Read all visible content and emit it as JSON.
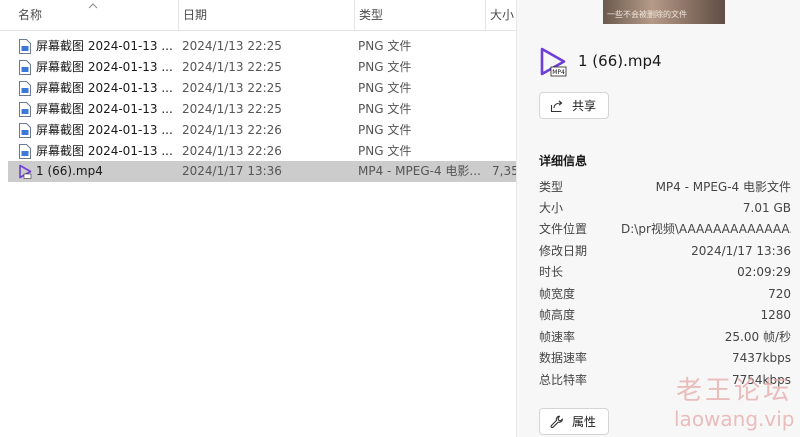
{
  "columns": {
    "name": "名称",
    "date": "日期",
    "type": "类型",
    "size": "大小"
  },
  "files": [
    {
      "name": "屏幕截图 2024-01-13 ...",
      "date": "2024/1/13 22:25",
      "type": "PNG 文件",
      "size": "",
      "icon": "png-file-icon"
    },
    {
      "name": "屏幕截图 2024-01-13 ...",
      "date": "2024/1/13 22:25",
      "type": "PNG 文件",
      "size": "",
      "icon": "png-file-icon"
    },
    {
      "name": "屏幕截图 2024-01-13 ...",
      "date": "2024/1/13 22:25",
      "type": "PNG 文件",
      "size": "",
      "icon": "png-file-icon"
    },
    {
      "name": "屏幕截图 2024-01-13 ...",
      "date": "2024/1/13 22:25",
      "type": "PNG 文件",
      "size": "",
      "icon": "png-file-icon"
    },
    {
      "name": "屏幕截图 2024-01-13 ...",
      "date": "2024/1/13 22:26",
      "type": "PNG 文件",
      "size": "",
      "icon": "png-file-icon"
    },
    {
      "name": "屏幕截图 2024-01-13 ...",
      "date": "2024/1/13 22:26",
      "type": "PNG 文件",
      "size": "",
      "icon": "png-file-icon"
    },
    {
      "name": "1 (66).mp4",
      "date": "2024/1/17 13:36",
      "type": "MP4 - MPEG-4 电影...",
      "size": "7,35",
      "icon": "mp4-file-icon",
      "selected": true
    }
  ],
  "details": {
    "thumbnail_caption": "一些不会被删除的文件",
    "title": "1 (66).mp4",
    "badge": "MP4",
    "share_label": "共享",
    "section_title": "详细信息",
    "properties": [
      {
        "key": "类型",
        "value": "MP4 - MPEG-4 电影文件"
      },
      {
        "key": "大小",
        "value": "7.01 GB"
      },
      {
        "key": "文件位置",
        "value": "D:\\pr视频\\AAAAAAAAAAAAA..."
      },
      {
        "key": "修改日期",
        "value": "2024/1/17 13:36"
      },
      {
        "key": "时长",
        "value": "02:09:29"
      },
      {
        "key": "帧宽度",
        "value": "720"
      },
      {
        "key": "帧高度",
        "value": "1280"
      },
      {
        "key": "帧速率",
        "value": "25.00 帧/秒"
      },
      {
        "key": "数据速率",
        "value": "7437kbps"
      },
      {
        "key": "总比特率",
        "value": "7754kbps"
      }
    ],
    "properties_label": "属性"
  },
  "watermark": {
    "line1": "老王论坛",
    "line2": "laowang.vip"
  },
  "colors": {
    "selection": "#cccccc",
    "mp4_icon": "#6d3fd8",
    "details_bg": "#f7f7f7"
  }
}
